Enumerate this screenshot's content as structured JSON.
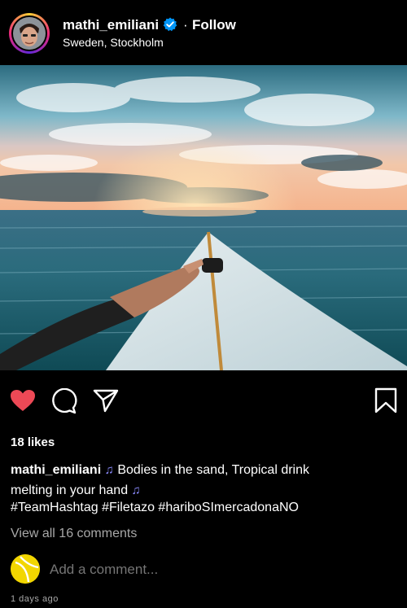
{
  "header": {
    "username": "mathi_emiliani",
    "separator": "·",
    "follow_label": "Follow",
    "location": "Sweden, Stockholm"
  },
  "post": {
    "image_alt": "Surfboard on the ocean at sunset with a hand resting on it",
    "likes": "18 likes",
    "caption_user": "mathi_emiliani",
    "caption_line1": "Bodies in the sand, Tropical drink",
    "caption_line2": "melting in your hand",
    "note_icon": "♫",
    "hashtags": "#TeamHashtag #Filetazo #hariboSImercadonaNO",
    "view_comments": "View all 16 comments",
    "comment_placeholder": "Add a comment...",
    "timestamp": "1 days ago"
  },
  "colors": {
    "like": "#ed4956",
    "verified": "#0095f6",
    "muted": "#a8a8a8"
  },
  "icons": [
    "heart-icon",
    "comment-icon",
    "share-icon",
    "bookmark-icon",
    "verified-icon"
  ]
}
